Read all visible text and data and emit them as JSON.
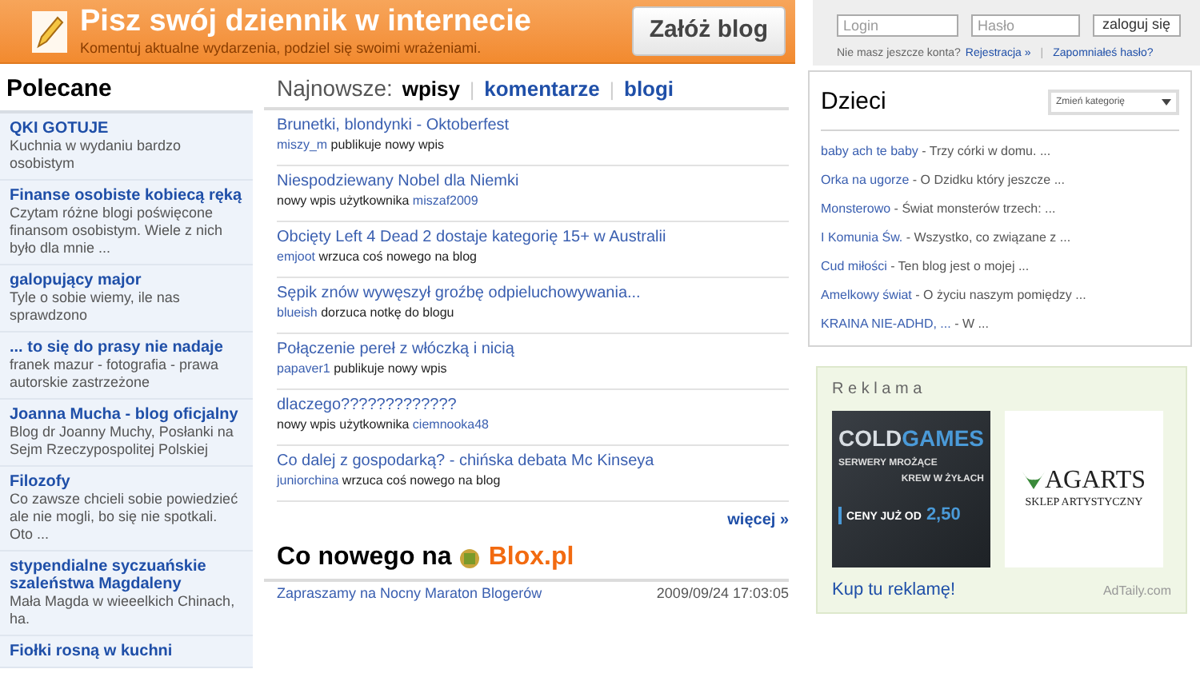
{
  "banner": {
    "title": "Pisz swój dziennik w internecie",
    "subtitle": "Komentuj aktualne wydarzenia, podziel się swoimi wrażeniami.",
    "button": "Załóż blog"
  },
  "login": {
    "login_placeholder": "Login",
    "password_placeholder": "Hasło",
    "button": "zaloguj się",
    "no_account": "Nie masz jeszcze konta?",
    "register": "Rejestracja »",
    "separator": "|",
    "forgot": "Zapomniałeś hasło?"
  },
  "recommended": {
    "title": "Polecane",
    "items": [
      {
        "title": "QKI GOTUJE",
        "desc": "Kuchnia w wydaniu bardzo osobistym"
      },
      {
        "title": "Finanse osobiste kobiecą ręką",
        "desc": "Czytam różne blogi poświęcone finansom osobistym. Wiele z nich było dla mnie ..."
      },
      {
        "title": "galopujący major",
        "desc": "Tyle o sobie wiemy, ile nas sprawdzono"
      },
      {
        "title": "... to się do prasy nie nadaje",
        "desc": "franek mazur - fotografia - prawa autorskie zastrzeżone"
      },
      {
        "title": "Joanna Mucha - blog oficjalny",
        "desc": "Blog dr Joanny Muchy, Posłanki na Sejm Rzeczypospolitej Polskiej"
      },
      {
        "title": "Filozofy",
        "desc": "Co zawsze chcieli sobie powiedzieć ale nie mogli, bo się nie spotkali. Oto ..."
      },
      {
        "title": "stypendialne syczuańskie szaleństwa Magdaleny",
        "desc": "Mała Magda w wieeelkich Chinach, ha."
      },
      {
        "title": "Fiołki rosną w kuchni"
      }
    ]
  },
  "latest": {
    "label": "Najnowsze:",
    "tabs": [
      {
        "label": "wpisy",
        "selected": true
      },
      {
        "label": "komentarze",
        "selected": false
      },
      {
        "label": "blogi",
        "selected": false
      }
    ],
    "separator": "|",
    "entries": [
      {
        "title": "Brunetki, blondynki - Oktoberfest",
        "meta": [
          {
            "kind": "user",
            "text": "miszy_m"
          },
          {
            "kind": "text",
            "text": "publikuje nowy wpis"
          }
        ]
      },
      {
        "title": "Niespodziewany Nobel dla Niemki",
        "meta": [
          {
            "kind": "text",
            "text": "nowy wpis użytkownika"
          },
          {
            "kind": "user",
            "text": "miszaf2009"
          }
        ]
      },
      {
        "title": "Obcięty Left 4 Dead 2 dostaje kategorię 15+ w Australii",
        "meta": [
          {
            "kind": "user",
            "text": "emjoot"
          },
          {
            "kind": "text",
            "text": "wrzuca coś nowego na blog"
          }
        ]
      },
      {
        "title": "Sępik znów wywęszył groźbę odpieluchowywania...",
        "meta": [
          {
            "kind": "user",
            "text": "blueish"
          },
          {
            "kind": "text",
            "text": "dorzuca notkę do blogu"
          }
        ]
      },
      {
        "title": "Połączenie pereł z włóczką i nicią",
        "meta": [
          {
            "kind": "user",
            "text": "papaver1"
          },
          {
            "kind": "text",
            "text": "publikuje nowy wpis"
          }
        ]
      },
      {
        "title": "dlaczego?????????????",
        "meta": [
          {
            "kind": "text",
            "text": "nowy wpis użytkownika"
          },
          {
            "kind": "user",
            "text": "ciemnooka48"
          }
        ]
      },
      {
        "title": "Co dalej z gospodarką? - chińska debata Mc Kinseya",
        "meta": [
          {
            "kind": "user",
            "text": "juniorchina"
          },
          {
            "kind": "text",
            "text": "wrzuca coś nowego na blog"
          }
        ]
      }
    ],
    "more": "więcej »"
  },
  "news": {
    "title": "Co nowego na",
    "brand": "Blox.pl",
    "items": [
      {
        "title": "Zapraszamy na Nocny Maraton Blogerów",
        "date": "2009/09/24 17:03:05"
      }
    ]
  },
  "category": {
    "title": "Dzieci",
    "select": "Zmień kategorię",
    "items": [
      {
        "name": "baby ach te baby",
        "desc": "- Trzy córki w domu. ..."
      },
      {
        "name": "Orka na ugorze",
        "desc": "- O Dzidku który jeszcze ..."
      },
      {
        "name": "Monsterowo",
        "desc": "- Świat monsterów trzech: ..."
      },
      {
        "name": "I Komunia Św.",
        "desc": "- Wszystko, co związane z ..."
      },
      {
        "name": "Cud miłości",
        "desc": "- Ten blog jest o mojej ..."
      },
      {
        "name": "Amelkowy świat",
        "desc": "- O życiu naszym pomiędzy ..."
      },
      {
        "name": "KRAINA NIE-ADHD, ...",
        "desc": "- W ..."
      }
    ]
  },
  "ads": {
    "title": "R e k l a m a",
    "ad_1": {
      "brand_a": "COLD",
      "brand_b": "GAMES",
      "line_1": "SERWERY MROŻĄCE",
      "line_2": "KREW W ŻYŁACH",
      "price_label": "CENY JUŻ OD",
      "price": "2,50"
    },
    "ad_2": {
      "brand": "AGARTS",
      "tagline": "SKLEP ARTYSTYCZNY"
    },
    "buy": "Kup tu reklamę!",
    "provider": "AdTaily.com"
  }
}
